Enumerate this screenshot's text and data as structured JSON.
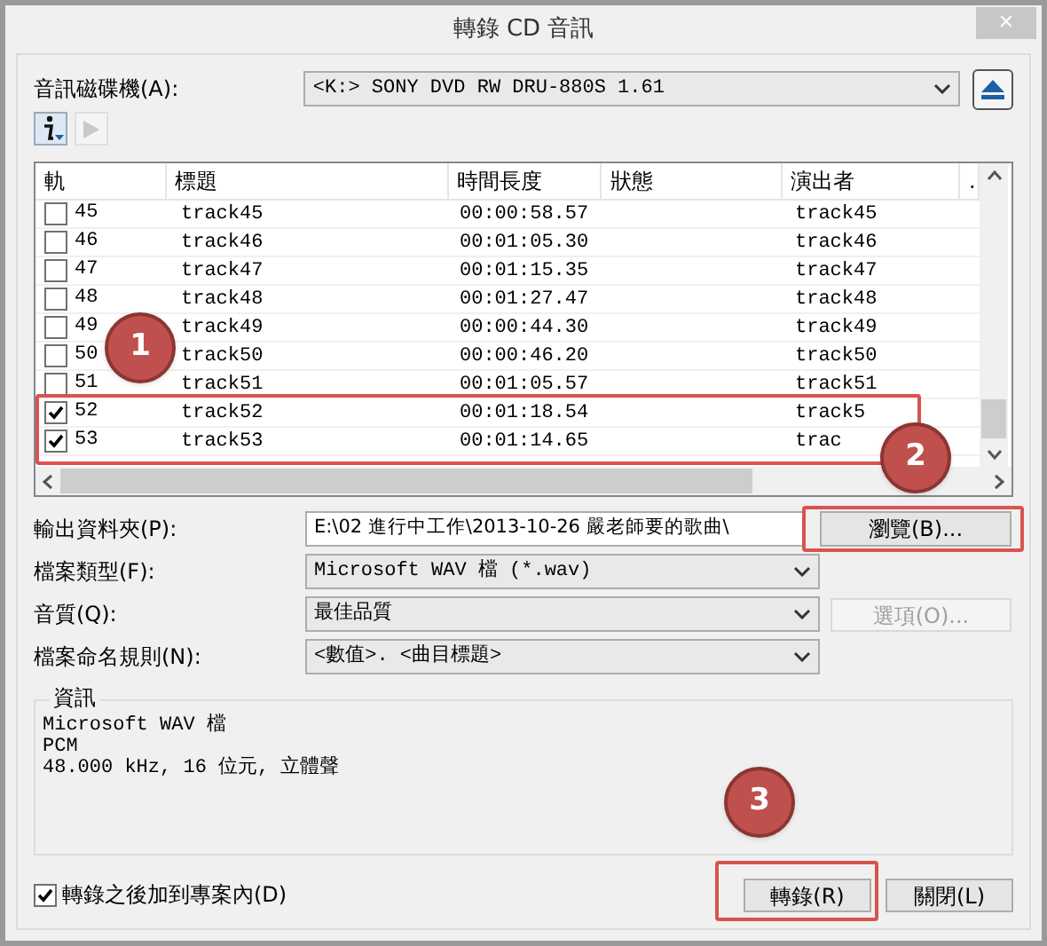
{
  "window": {
    "title": "轉錄 CD 音訊",
    "close": "✕"
  },
  "drive": {
    "label": "音訊磁碟機(A):",
    "value": "<K:>  SONY DVD RW DRU-880S 1.61"
  },
  "table": {
    "columns": [
      "軌",
      "標題",
      "時間長度",
      "狀態",
      "演出者",
      "."
    ],
    "rows": [
      {
        "track": "45",
        "title": "track45",
        "length": "00:00:58.57",
        "status": "",
        "artist": "track45",
        "checked": false
      },
      {
        "track": "46",
        "title": "track46",
        "length": "00:01:05.30",
        "status": "",
        "artist": "track46",
        "checked": false
      },
      {
        "track": "47",
        "title": "track47",
        "length": "00:01:15.35",
        "status": "",
        "artist": "track47",
        "checked": false
      },
      {
        "track": "48",
        "title": "track48",
        "length": "00:01:27.47",
        "status": "",
        "artist": "track48",
        "checked": false
      },
      {
        "track": "49",
        "title": "track49",
        "length": "00:00:44.30",
        "status": "",
        "artist": "track49",
        "checked": false
      },
      {
        "track": "50",
        "title": "track50",
        "length": "00:00:46.20",
        "status": "",
        "artist": "track50",
        "checked": false
      },
      {
        "track": "51",
        "title": "track51",
        "length": "00:01:05.57",
        "status": "",
        "artist": "track51",
        "checked": false
      },
      {
        "track": "52",
        "title": "track52",
        "length": "00:01:18.54",
        "status": "",
        "artist": "track5",
        "checked": true
      },
      {
        "track": "53",
        "title": "track53",
        "length": "00:01:14.65",
        "status": "",
        "artist": "trac",
        "checked": true
      }
    ]
  },
  "output_folder": {
    "label": "輸出資料夾(P):",
    "value": "E:\\02 進行中工作\\2013-10-26 嚴老師要的歌曲\\",
    "button": "瀏覽(B)..."
  },
  "file_type": {
    "label": "檔案類型(F):",
    "value": "Microsoft WAV 檔 (*.wav)"
  },
  "quality": {
    "label": "音質(Q):",
    "value": "最佳品質",
    "button": "選項(O)...",
    "button_disabled": true
  },
  "naming": {
    "label": "檔案命名規則(N):",
    "value": "<數值>. <曲目標題>"
  },
  "info": {
    "title": "資訊",
    "lines": [
      "Microsoft WAV 檔",
      "PCM",
      "48.000 kHz, 16 位元, 立體聲"
    ]
  },
  "add_to_project": {
    "label": "轉錄之後加到專案內(D)",
    "checked": true
  },
  "buttons": [
    "轉錄(R)",
    "關閉(L)"
  ],
  "callouts": [
    "1",
    "2",
    "3"
  ]
}
